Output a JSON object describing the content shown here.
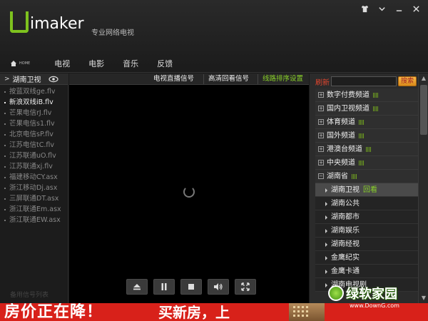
{
  "app": {
    "logo_text": "imaker",
    "slogan": "专业网络电视"
  },
  "nav": {
    "home_label": "HOME",
    "items": [
      "电视",
      "电影",
      "音乐",
      "反馈"
    ]
  },
  "left_panel": {
    "title": "湖南卫视",
    "files": [
      "按蓝双线ge.flv",
      "新浪双线iB.flv",
      "芒果电信rJ.flv",
      "芒果电信s1.flv",
      "北京电信sP.flv",
      "江苏电信tC.flv",
      "江苏联通uO.flv",
      "江苏联通xj.flv",
      "福建移动CY.asx",
      "浙江移动Dj.asx",
      "三屏联通DT.asx",
      "浙江联通Em.asx",
      "浙江联通EW.asx"
    ],
    "active_index": 1,
    "footer_text": "备用信号列表"
  },
  "player": {
    "signal_tabs": [
      "电视直播信号",
      "高清回看信号",
      "线路排序设置"
    ],
    "active_tab": 2,
    "controls": [
      "eject-icon",
      "pause-icon",
      "stop-icon",
      "volume-icon",
      "fullscreen-icon"
    ]
  },
  "right_panel": {
    "refresh_label": "刷新",
    "search_placeholder": "",
    "search_button": "搜索",
    "categories": [
      {
        "name": "数字付费频道",
        "expanded": false
      },
      {
        "name": "国内卫视频道",
        "expanded": false
      },
      {
        "name": "体育频道",
        "expanded": false
      },
      {
        "name": "国外频道",
        "expanded": false
      },
      {
        "name": "港澳台频道",
        "expanded": false
      },
      {
        "name": "中央频道",
        "expanded": false
      },
      {
        "name": "湖南省",
        "expanded": true
      }
    ],
    "channels": [
      {
        "name": "湖南卫视",
        "action": "回看",
        "active": true
      },
      {
        "name": "湖南公共",
        "action": "",
        "active": false
      },
      {
        "name": "湖南都市",
        "action": "",
        "active": false
      },
      {
        "name": "湖南娱乐",
        "action": "",
        "active": false
      },
      {
        "name": "湖南经视",
        "action": "",
        "active": false
      },
      {
        "name": "金鹰纪实",
        "action": "",
        "active": false
      },
      {
        "name": "金鹰卡通",
        "action": "",
        "active": false
      },
      {
        "name": "湖南电视剧",
        "action": "",
        "active": false
      }
    ]
  },
  "ad": {
    "headline": "房价正在降！",
    "sub": "买新房，上"
  },
  "watermark": {
    "brand": "绿软家园",
    "url": "www.DownG.com"
  },
  "colors": {
    "accent_green": "#8ad12a",
    "refresh_red": "#e0452e",
    "ad_red": "#d8211a"
  }
}
